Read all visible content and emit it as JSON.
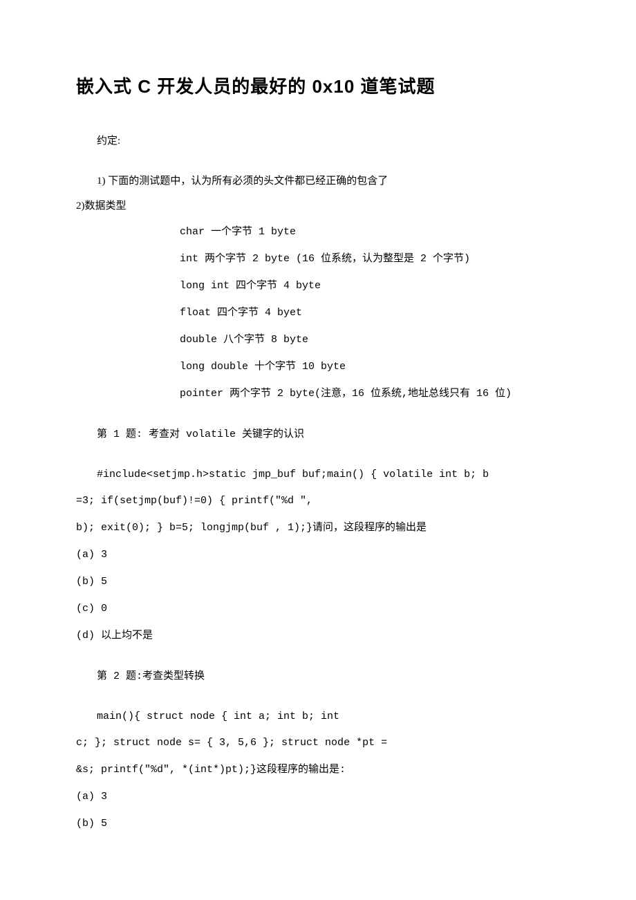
{
  "title": "嵌入式 C 开发人员的最好的 0x10 道笔试题",
  "intro": "约定:",
  "assumptions": {
    "line1": "1) 下面的测试题中，认为所有必须的头文件都已经正确的包含了",
    "line2": "2)数据类型"
  },
  "types": {
    "t1": "char 一个字节 1 byte",
    "t2": "int 两个字节 2 byte (16 位系统，认为整型是 2 个字节)",
    "t3": "long int 四个字节 4 byte",
    "t4": "float 四个字节 4 byet",
    "t5": "double 八个字节 8 byte",
    "t6": "long double 十个字节 10 byte",
    "t7": "pointer 两个字节 2 byte(注意，16 位系统,地址总线只有 16 位)"
  },
  "q1": {
    "title": "第 1 题: 考查对 volatile 关键字的认识",
    "code1": "#include<setjmp.h>static jmp_buf   buf;main()       {   volatile   int b;   b",
    "code2": "=3;   if(setjmp(buf)!=0)       {       printf(\"%d \",",
    "code3": "b);           exit(0);   }   b=5;   longjmp(buf , 1);}请问，这段程序的输出是",
    "opt_a": "(a) 3",
    "opt_b": "(b) 5",
    "opt_c": "(c) 0",
    "opt_d": "(d) 以上均不是"
  },
  "q2": {
    "title": "第 2 题:考查类型转换",
    "code1": "main(){     struct node       {         int a;        int b;         int",
    "code2": "c;            };     struct node   s= { 3, 5,6 };     struct node *pt =",
    "code3": "&s;     printf(\"%d\",   *(int*)pt);}这段程序的输出是:",
    "opt_a": "(a) 3",
    "opt_b": "(b) 5"
  }
}
